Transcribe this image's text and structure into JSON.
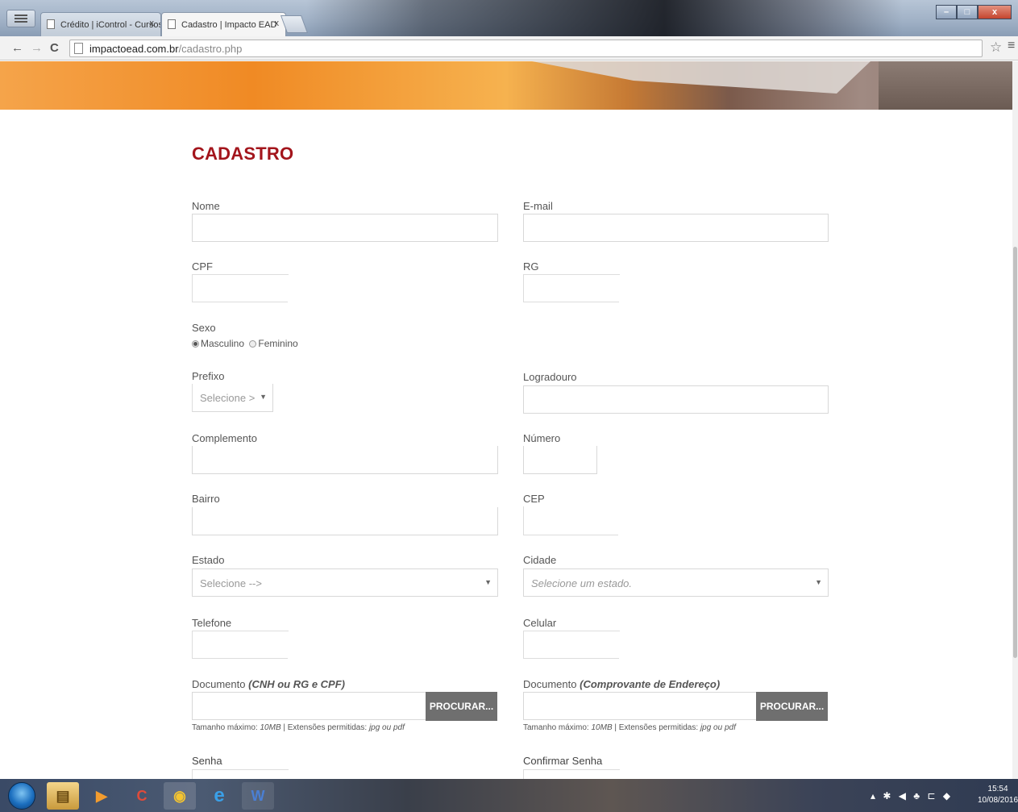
{
  "browser": {
    "tabs": [
      {
        "label": "Crédito | iControl - Cursos"
      },
      {
        "label": "Cadastro | Impacto EAD"
      }
    ],
    "tab_close": "x",
    "url_host": "impactoead.com.br",
    "url_path": "/cadastro.php",
    "nav": {
      "back": "←",
      "forward": "→",
      "reload": "C"
    },
    "star": "☆",
    "menu": "≡",
    "window_controls": {
      "minimize": "–",
      "maximize": "□",
      "close": "x"
    }
  },
  "form": {
    "title": "CADASTRO",
    "nome_label": "Nome",
    "email_label": "E-mail",
    "cpf_label": "CPF",
    "rg_label": "RG",
    "sexo_label": "Sexo",
    "sexo_options": [
      "Masculino",
      "Feminino"
    ],
    "sexo_selected": "Masculino",
    "prefixo_label": "Prefixo",
    "prefixo_value": "Selecione >",
    "logradouro_label": "Logradouro",
    "complemento_label": "Complemento",
    "numero_label": "Número",
    "bairro_label": "Bairro",
    "cep_label": "CEP",
    "estado_label": "Estado",
    "estado_value": "Selecione -->",
    "cidade_label": "Cidade",
    "cidade_value": "Selecione um estado.",
    "telefone_label": "Telefone",
    "celular_label": "Celular",
    "doc1_label": "Documento",
    "doc1_label_em": "(CNH ou RG e CPF)",
    "doc2_label": "Documento",
    "doc2_label_em": "(Comprovante de Endereço)",
    "browse_button": "PROCURAR...",
    "hint_prefix": "Tamanho máximo:",
    "hint_size": "10MB",
    "hint_sep": "| Extensões permitidas:",
    "hint_ext": "jpg ou pdf",
    "senha_label": "Senha",
    "confirmar_senha_label": "Confirmar Senha"
  },
  "taskbar": {
    "icons": [
      "explorer",
      "media-player",
      "ccleaner",
      "chrome",
      "internet-explorer",
      "word"
    ],
    "clock_time": "15:54",
    "clock_date": "10/08/2016"
  }
}
